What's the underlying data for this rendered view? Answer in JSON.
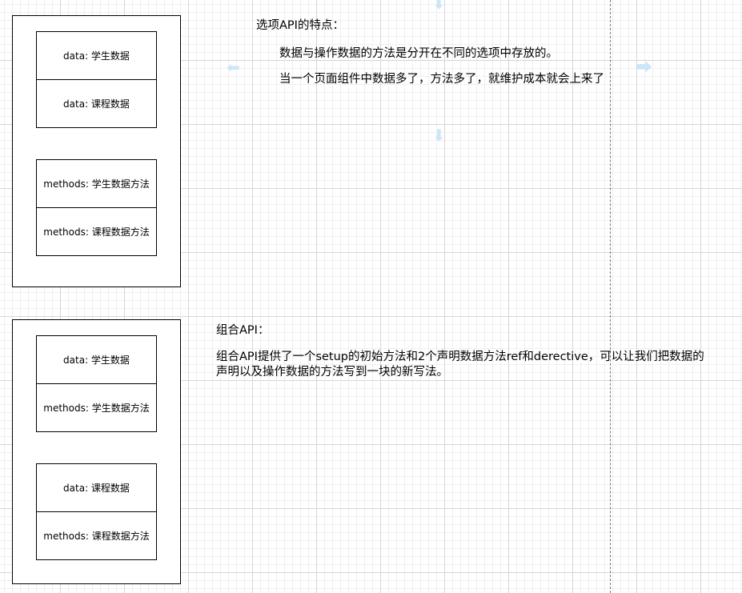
{
  "top_diagram": {
    "cells": [
      "data: 学生数据",
      "data: 课程数据",
      "methods: 学生数据方法",
      "methods: 课程数据方法"
    ]
  },
  "options_api": {
    "title": "选项API的特点：",
    "line1": "数据与操作数据的方法是分开在不同的选项中存放的。",
    "line2": "当一个页面组件中数据多了，方法多了，就维护成本就会上来了"
  },
  "bottom_diagram": {
    "cells": [
      "data: 学生数据",
      "methods: 学生数据方法",
      "data: 课程数据",
      "methods: 课程数据方法"
    ]
  },
  "composition_api": {
    "title": "组合API：",
    "paragraph": "组合API提供了一个setup的初始方法和2个声明数据方法ref和derective，可以让我们把数据的声明以及操作数据的方法写到一块的新写法。"
  },
  "icons": {
    "guide_arrows": [
      "arrow-left-icon",
      "arrow-right-icon",
      "arrow-up-icon",
      "arrow-down-icon"
    ]
  }
}
